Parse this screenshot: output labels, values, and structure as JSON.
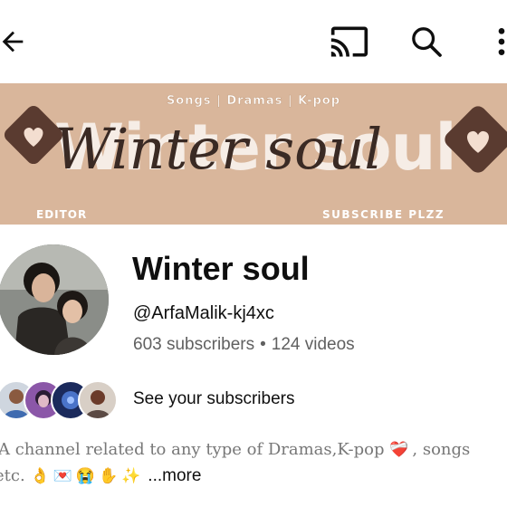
{
  "banner": {
    "tagline": "Songs | Dramas | K-pop",
    "big_title": "Winter soul",
    "script_title": "Winter soul",
    "editor_label": "EDITOR",
    "subscribe_label": "SUBSCRIBE PLZZ"
  },
  "channel": {
    "name": "Winter soul",
    "handle": "@ArfaMalik-kj4xc",
    "subscribers": "603 subscribers",
    "separator": "•",
    "videos": "124 videos"
  },
  "subscribers_link": "See your subscribers",
  "description": {
    "line1": "A channel related to any type of Dramas,K-pop",
    "line1_emoji": "❤️‍🩹",
    "line1_tail": ", songs",
    "line2": "etc.",
    "line2_emojis": [
      "👌",
      "💌",
      "😭",
      "✋",
      "✨"
    ],
    "more": "...more"
  },
  "icons": [
    "back-arrow-icon",
    "cast-icon",
    "search-icon",
    "more-vert-icon"
  ],
  "colors": {
    "banner_bg": "#d9b69b",
    "meta_gray": "#606060",
    "text": "#0f0f0f"
  }
}
